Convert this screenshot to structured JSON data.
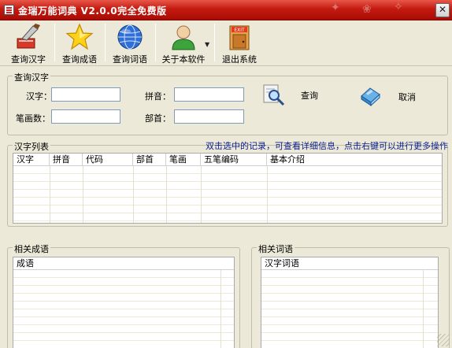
{
  "window": {
    "title": "金瑞万能词典 V2.0.0完全免费版"
  },
  "toolbar": {
    "buttons": [
      {
        "label": "查询汉字",
        "icon": "brush-icon"
      },
      {
        "label": "查询成语",
        "icon": "star-icon"
      },
      {
        "label": "查询词语",
        "icon": "globe-icon"
      },
      {
        "label": "关于本软件",
        "icon": "user-icon"
      },
      {
        "label": "退出系统",
        "icon": "exit-door-icon"
      }
    ]
  },
  "query": {
    "legend": "查询汉字",
    "hanzi_label": "汉字：",
    "hanzi_value": "",
    "pinyin_label": "拼音：",
    "pinyin_value": "",
    "strokes_label": "笔画数：",
    "strokes_value": "",
    "radical_label": "部首：",
    "radical_value": "",
    "search_label": "查询",
    "cancel_label": "取消"
  },
  "char_list": {
    "legend": "汉字列表",
    "hint": "双击选中的记录，可查看详细信息，点击右键可以进行更多操作",
    "columns": [
      "汉字",
      "拼音",
      "代码",
      "部首",
      "笔画",
      "五笔编码",
      "基本介绍"
    ],
    "rows": []
  },
  "idioms": {
    "legend": "相关成语",
    "columns": [
      "成语"
    ],
    "rows": []
  },
  "words": {
    "legend": "相关词语",
    "columns": [
      "汉字词语"
    ],
    "rows": []
  },
  "colors": {
    "title_bar": "#c41a10",
    "hint_text": "#0a1e8c",
    "background": "#ece9d8"
  }
}
